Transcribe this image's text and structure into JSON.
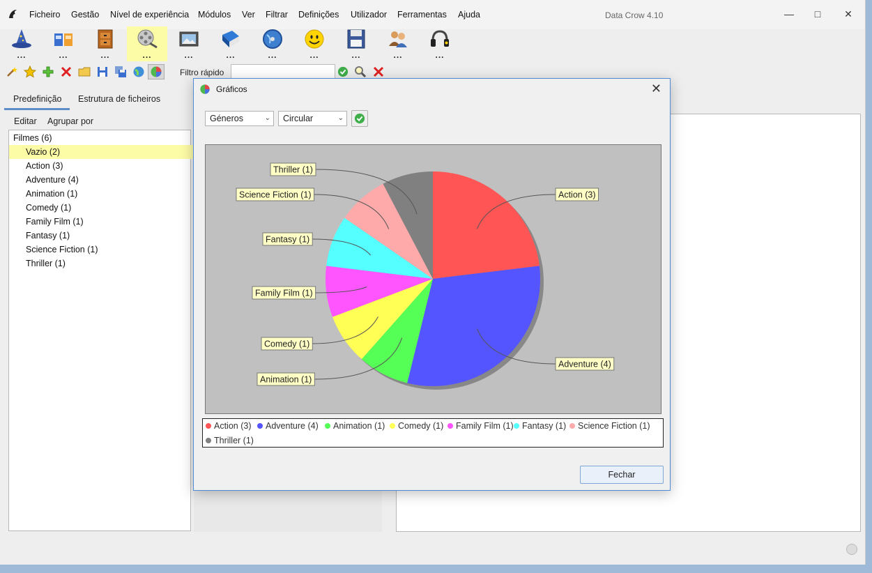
{
  "window": {
    "title": "Data Crow 4.10",
    "menu": [
      "Ficheiro",
      "Gestão",
      "Nível de experiência",
      "Módulos",
      "Ver",
      "Filtrar",
      "Definições",
      "Utilizador",
      "Ferramentas",
      "Ajuda"
    ]
  },
  "modules": [
    {
      "icon": "wizard-hat-icon",
      "label": "..."
    },
    {
      "icon": "containers-icon",
      "label": "..."
    },
    {
      "icon": "cabinet-icon",
      "label": "..."
    },
    {
      "icon": "film-reel-icon",
      "label": "...",
      "active": true
    },
    {
      "icon": "image-icon",
      "label": "..."
    },
    {
      "icon": "book-icon",
      "label": "..."
    },
    {
      "icon": "globe-disc-icon",
      "label": "..."
    },
    {
      "icon": "smiley-icon",
      "label": "..."
    },
    {
      "icon": "floppy-disk-icon",
      "label": "..."
    },
    {
      "icon": "users-icon",
      "label": "..."
    },
    {
      "icon": "headphones-icon",
      "label": "..."
    }
  ],
  "toolbar": {
    "quick_filter_label": "Filtro rápido",
    "quick_filter_value": ""
  },
  "tabs": [
    "Predefinição",
    "Estrutura de ficheiros"
  ],
  "subbar": {
    "edit": "Editar",
    "group_by": "Agrupar por"
  },
  "tree": {
    "root": "Filmes (6)",
    "items": [
      "Vazio (2)",
      "Action (3)",
      "Adventure (4)",
      "Animation (1)",
      "Comedy (1)",
      "Family Film (1)",
      "Fantasy (1)",
      "Science Fiction (1)",
      "Thriller (1)"
    ],
    "selected_index": 0
  },
  "dialog": {
    "title": "Gráficos",
    "field_select": "Géneros",
    "type_select": "Circular",
    "close_label": "Fechar"
  },
  "chart_data": {
    "type": "pie",
    "categories": [
      "Action",
      "Adventure",
      "Animation",
      "Comedy",
      "Family Film",
      "Fantasy",
      "Science Fiction",
      "Thriller"
    ],
    "values": [
      3,
      4,
      1,
      1,
      1,
      1,
      1,
      1
    ],
    "labels": [
      "Action (3)",
      "Adventure (4)",
      "Animation (1)",
      "Comedy (1)",
      "Family Film (1)",
      "Fantasy (1)",
      "Science Fiction (1)",
      "Thriller (1)"
    ],
    "colors": [
      "#ff5555",
      "#5555ff",
      "#55ff55",
      "#ffff55",
      "#ff55ff",
      "#55ffff",
      "#ffaaaa",
      "#808080"
    ],
    "legend_position": "bottom"
  }
}
